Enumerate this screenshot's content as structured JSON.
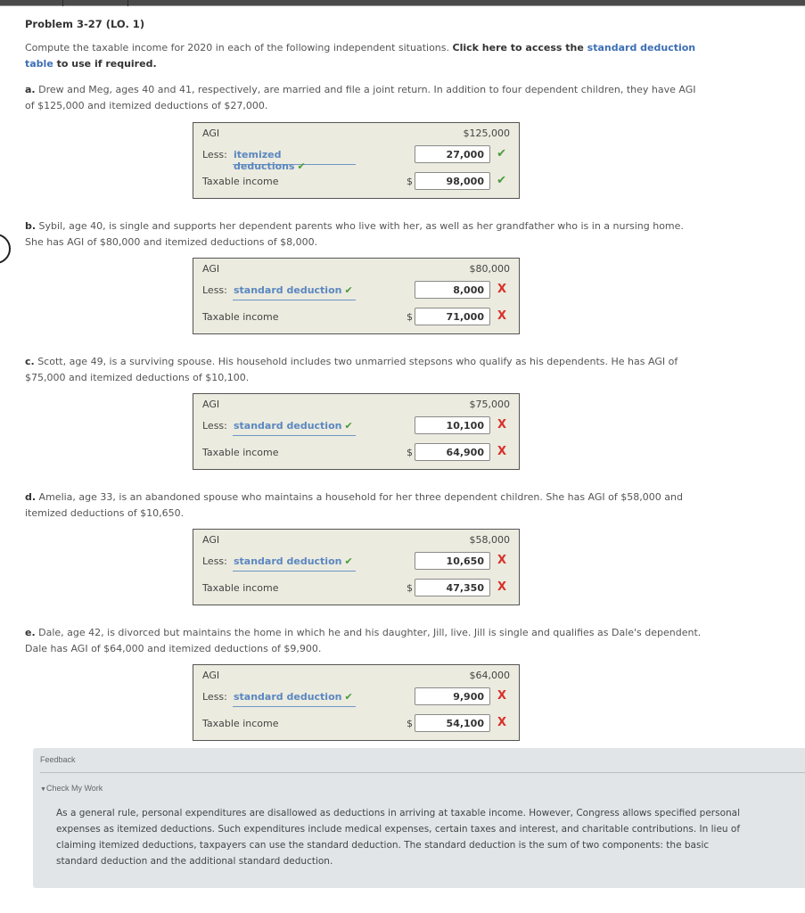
{
  "problem": {
    "title": "Problem 3-27 (LO. 1)",
    "intro_text": "Compute the taxable income for 2020 in each of the following independent situations. ",
    "intro_bold": "Click here to access the ",
    "intro_link": "standard deduction table",
    "intro_bold_end": " to use if required."
  },
  "parts": [
    {
      "letter": "a.",
      "text": " Drew and Meg, ages 40 and 41, respectively, are married and file a joint return. In addition to four dependent children, they have AGI of $125,000 and itemized deductions of $27,000.",
      "agi_label": "AGI",
      "agi_value": "$125,000",
      "less_label": "Less:",
      "deduction_type": "itemized deductions",
      "deduction_type_status": "correct",
      "deduction_value": "27,000",
      "deduction_status": "correct",
      "taxable_label": "Taxable income",
      "currency": "$",
      "taxable_value": "98,000",
      "taxable_status": "correct"
    },
    {
      "letter": "b.",
      "text": " Sybil, age 40, is single and supports her dependent parents who live with her, as well as her grandfather who is in a nursing home. She has AGI of $80,000 and itemized deductions of $8,000.",
      "agi_label": "AGI",
      "agi_value": "$80,000",
      "less_label": "Less:",
      "deduction_type": "standard deduction",
      "deduction_type_status": "correct",
      "deduction_value": "8,000",
      "deduction_status": "incorrect",
      "taxable_label": "Taxable income",
      "currency": "$",
      "taxable_value": "71,000",
      "taxable_status": "incorrect"
    },
    {
      "letter": "c.",
      "text": " Scott, age 49, is a surviving spouse. His household includes two unmarried stepsons who qualify as his dependents. He has AGI of $75,000 and itemized deductions of $10,100.",
      "agi_label": "AGI",
      "agi_value": "$75,000",
      "less_label": "Less:",
      "deduction_type": "standard deduction",
      "deduction_type_status": "correct",
      "deduction_value": "10,100",
      "deduction_status": "incorrect",
      "taxable_label": "Taxable income",
      "currency": "$",
      "taxable_value": "64,900",
      "taxable_status": "incorrect"
    },
    {
      "letter": "d.",
      "text": " Amelia, age 33, is an abandoned spouse who maintains a household for her three dependent children. She has AGI of $58,000 and itemized deductions of $10,650.",
      "agi_label": "AGI",
      "agi_value": "$58,000",
      "less_label": "Less:",
      "deduction_type": "standard deduction",
      "deduction_type_status": "correct",
      "deduction_value": "10,650",
      "deduction_status": "incorrect",
      "taxable_label": "Taxable income",
      "currency": "$",
      "taxable_value": "47,350",
      "taxable_status": "incorrect"
    },
    {
      "letter": "e.",
      "text": " Dale, age 42, is divorced but maintains the home in which he and his daughter, Jill, live. Jill is single and qualifies as Dale's dependent. Dale has AGI of $64,000 and itemized deductions of $9,900.",
      "agi_label": "AGI",
      "agi_value": "$64,000",
      "less_label": "Less:",
      "deduction_type": "standard deduction",
      "deduction_type_status": "correct",
      "deduction_value": "9,900",
      "deduction_status": "incorrect",
      "taxable_label": "Taxable income",
      "currency": "$",
      "taxable_value": "54,100",
      "taxable_status": "incorrect"
    }
  ],
  "icons": {
    "check": "✔",
    "cross": "X",
    "triangle": "▼"
  },
  "colors": {
    "link": "#3c6eb4",
    "correct": "#4a9a3a",
    "incorrect": "#d9302a",
    "answer_box_bg": "#ebebdf",
    "feedback_bg": "#e1e5e8"
  },
  "feedback": {
    "heading": "Feedback",
    "toggle_label": "Check My Work",
    "text": "As a general rule, personal expenditures are disallowed as deductions in arriving at taxable income. However, Congress allows specified personal expenses as itemized deductions. Such expenditures include medical expenses, certain taxes and interest, and charitable contributions. In lieu of claiming itemized deductions, taxpayers can use the standard deduction. The standard deduction is the sum of two components: the basic standard deduction and the additional standard deduction."
  }
}
